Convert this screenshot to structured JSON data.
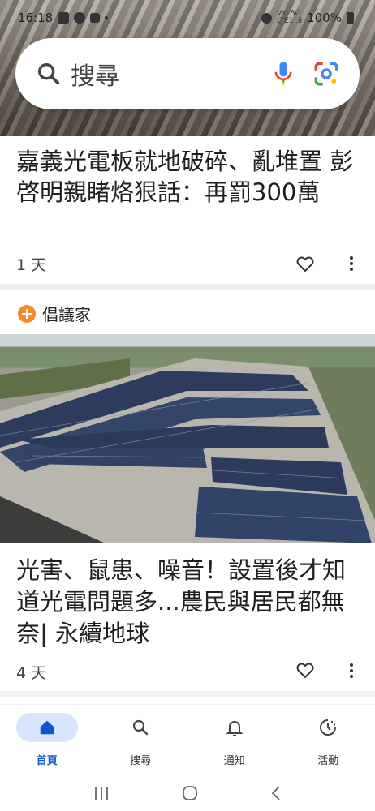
{
  "status": {
    "time": "16:18",
    "signal_text_1": "Vo) 5G",
    "signal_text_2": "LTE1 .ıl",
    "battery": "100%"
  },
  "search": {
    "placeholder": "搜尋"
  },
  "articles": [
    {
      "title": "嘉義光電板就地破碎、亂堆置 彭啓明親睹烙狠話：再罰300萬",
      "age": "1 天"
    },
    {
      "source": "倡議家",
      "title": "光害、鼠患、噪音！設置後才知道光電問題多...農民與居民都無奈| 永續地球",
      "age": "4 天"
    }
  ],
  "nav": {
    "items": [
      {
        "label": "首頁",
        "icon": "home-icon",
        "active": true
      },
      {
        "label": "搜尋",
        "icon": "search-icon",
        "active": false
      },
      {
        "label": "通知",
        "icon": "bell-icon",
        "active": false
      },
      {
        "label": "活動",
        "icon": "activity-icon",
        "active": false
      }
    ]
  },
  "colors": {
    "accent": "#0b57d0",
    "active_pill": "#d9e5ff",
    "source_logo": "#f28c28"
  }
}
